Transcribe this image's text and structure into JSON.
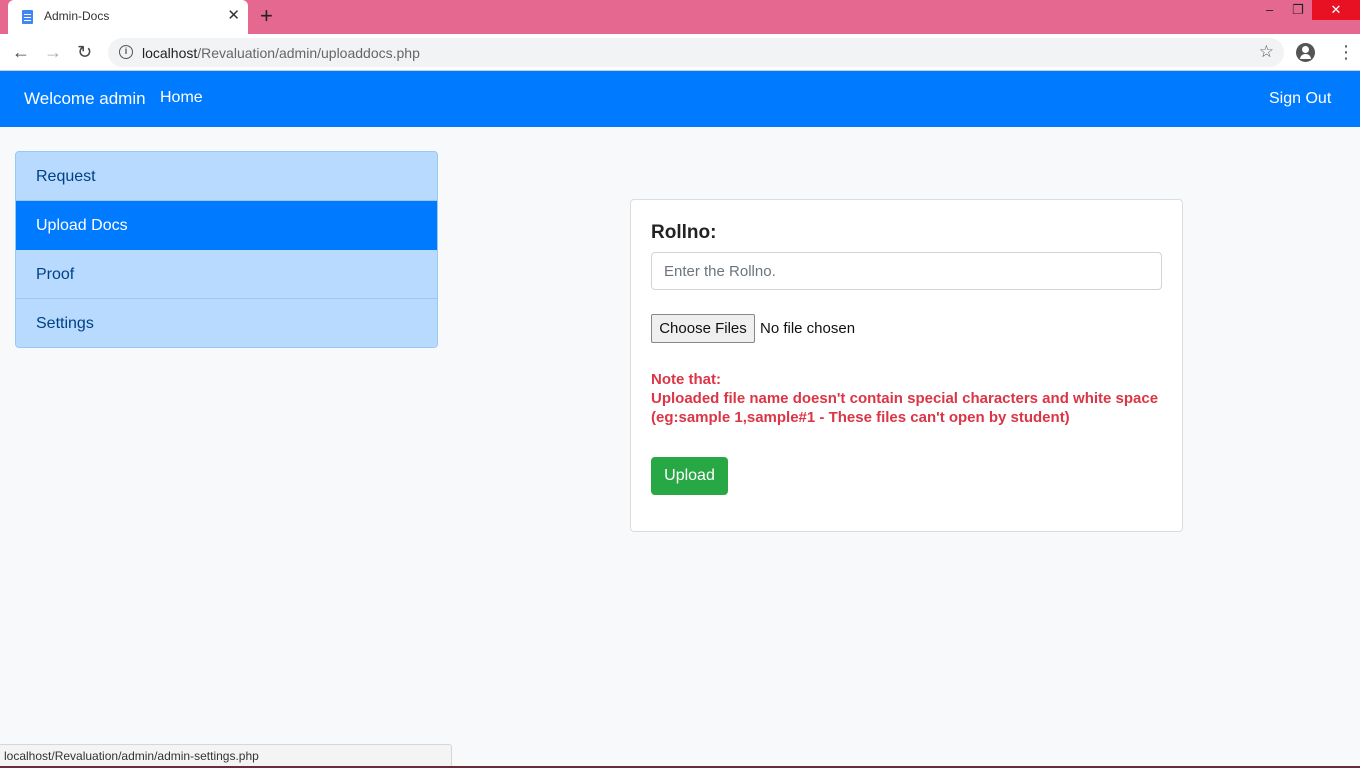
{
  "browser": {
    "tab_title": "Admin-Docs",
    "tab_close": "✕",
    "new_tab": "+",
    "url_host": "localhost",
    "url_path": "/Revaluation/admin/uploaddocs.php",
    "status_url": "localhost/Revaluation/admin/admin-settings.php",
    "window_controls": {
      "minimize": "–",
      "restore": "❐",
      "close": "✕"
    },
    "icons": [
      "back-icon",
      "forward-icon",
      "reload-icon",
      "info-icon",
      "star-icon",
      "profile-icon",
      "menu-icon"
    ]
  },
  "navbar": {
    "brand": "Welcome admin",
    "home": "Home",
    "signout": "Sign Out",
    "color": "#007bff"
  },
  "sidebar": {
    "items": [
      {
        "label": "Request",
        "active": false
      },
      {
        "label": "Upload Docs",
        "active": true
      },
      {
        "label": "Proof",
        "active": false
      },
      {
        "label": "Settings",
        "active": false
      }
    ]
  },
  "form": {
    "rollno_label": "Rollno:",
    "rollno_placeholder": "Enter the Rollno.",
    "rollno_value": "",
    "choose_files_label": "Choose Files",
    "file_status": "No file chosen",
    "note_title": "Note that:",
    "note_line1": "Uploaded file name doesn't contain special characters and white space",
    "note_line2": "(eg:sample 1,sample#1 - These files can't open by student)",
    "upload_label": "Upload",
    "note_color": "#dc3545",
    "upload_color": "#28a745"
  }
}
